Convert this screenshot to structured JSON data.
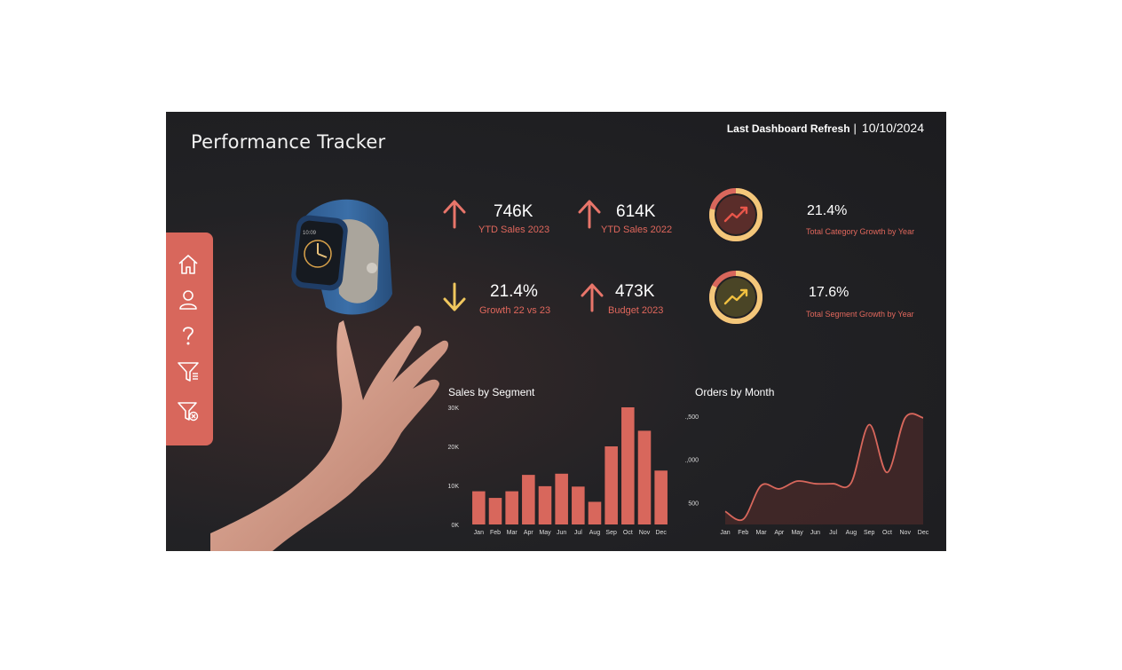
{
  "header": {
    "title": "Performance Tracker",
    "refresh_label": "Last Dashboard Refresh",
    "refresh_separator": "|",
    "refresh_date": "10/10/2024"
  },
  "sidebar": {
    "items": [
      {
        "name": "home-icon"
      },
      {
        "name": "user-icon"
      },
      {
        "name": "help-icon"
      },
      {
        "name": "filter-icon"
      },
      {
        "name": "filter-clear-icon"
      }
    ]
  },
  "kpis": [
    {
      "value": "746K",
      "label": "YTD Sales 2023",
      "direction": "up",
      "color": "#e8756a"
    },
    {
      "value": "614K",
      "label": "YTD Sales 2022",
      "direction": "up",
      "color": "#e8756a"
    },
    {
      "value": "21.4%",
      "label": "Growth 22 vs 23",
      "direction": "down",
      "color": "#f0c75e"
    },
    {
      "value": "473K",
      "label": "Budget 2023",
      "direction": "up",
      "color": "#e8756a"
    }
  ],
  "growth": [
    {
      "value": "21.4%",
      "label": "Total Category Growth by Year",
      "icon": "trend-up-icon",
      "inner_color": "#5a2d2a",
      "arrow_color": "#e8564a",
      "fraction": 0.214
    },
    {
      "value": "17.6%",
      "label": "Total Segment Growth by Year",
      "icon": "trend-up-icon",
      "inner_color": "#4a4526",
      "arrow_color": "#f0c040",
      "fraction": 0.176
    }
  ],
  "colors": {
    "accent": "#d8675c",
    "ring_yellow": "#f3c77a",
    "text_red": "#e0675c"
  },
  "chart_data": [
    {
      "type": "bar",
      "title": "Sales by Segment",
      "categories": [
        "Jan",
        "Feb",
        "Mar",
        "Apr",
        "May",
        "Jun",
        "Jul",
        "Aug",
        "Sep",
        "Oct",
        "Nov",
        "Dec"
      ],
      "values": [
        8500,
        6800,
        8500,
        12700,
        9800,
        13000,
        9700,
        5800,
        20000,
        30000,
        24000,
        13800
      ],
      "ylim": [
        0,
        30000
      ],
      "yticks": [
        0,
        10000,
        20000,
        30000
      ],
      "ytick_labels": [
        "0K",
        "10K",
        "20K",
        "30K"
      ],
      "color": "#d8675c"
    },
    {
      "type": "area",
      "title": "Orders by Month",
      "categories": [
        "Jan",
        "Feb",
        "Mar",
        "Apr",
        "May",
        "Jun",
        "Jul",
        "Aug",
        "Sep",
        "Oct",
        "Nov",
        "Dec"
      ],
      "values": [
        400,
        310,
        700,
        660,
        750,
        720,
        720,
        730,
        1400,
        850,
        1480,
        1480
      ],
      "ylim": [
        250,
        1600
      ],
      "yticks": [
        500,
        1000,
        1500
      ],
      "ytick_labels": [
        "500",
        "1,000",
        "1,500"
      ],
      "color": "#d8675c"
    }
  ]
}
